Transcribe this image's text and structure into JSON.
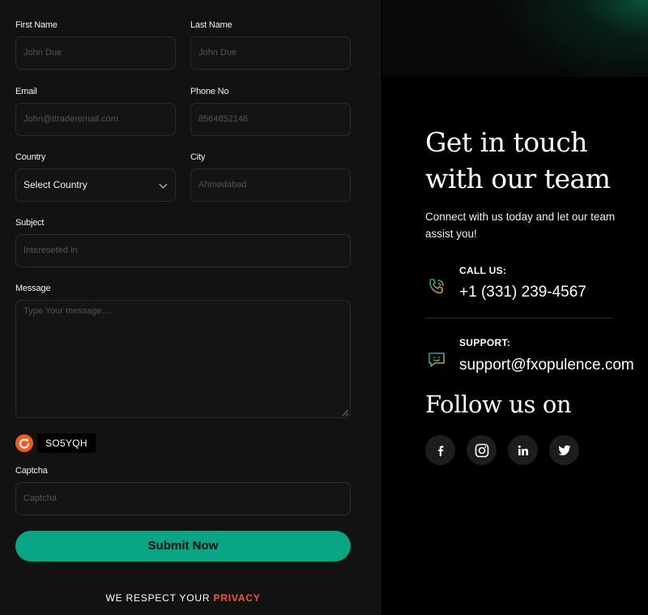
{
  "form": {
    "first_name": {
      "label": "First Name",
      "placeholder": "John Due"
    },
    "last_name": {
      "label": "Last Name",
      "placeholder": "John Due"
    },
    "email": {
      "label": "Email",
      "placeholder": "John@ttraderemail.com"
    },
    "phone": {
      "label": "Phone No",
      "placeholder": "8564852146"
    },
    "country": {
      "label": "Country",
      "value": "Select Country"
    },
    "city": {
      "label": "City",
      "placeholder": "Ahmedabad"
    },
    "subject": {
      "label": "Subject",
      "placeholder": "Intereseted in"
    },
    "message": {
      "label": "Message",
      "placeholder": "Type Your message...."
    },
    "captcha_code": "SO5YQH",
    "captcha": {
      "label": "Captcha",
      "placeholder": "Captcha"
    },
    "submit_label": "Submit Now",
    "privacy_prefix": "WE RESPECT YOUR",
    "privacy_link": "PRIVACY"
  },
  "info": {
    "headline": "Get in touch with our team",
    "subtext": "Connect with us today and let our team assist you!",
    "call_label": "CALL US:",
    "call_value": "+1 (331) 239-4567",
    "support_label": "SUPPORT:",
    "support_value": "support@fxopulence.com",
    "follow_title": "Follow us on",
    "socials": [
      "facebook-icon",
      "instagram-icon",
      "linkedin-icon",
      "twitter-icon"
    ]
  },
  "colors": {
    "accent": "#06a584",
    "highlight": "#f15a24",
    "panel_bg": "#121212"
  }
}
